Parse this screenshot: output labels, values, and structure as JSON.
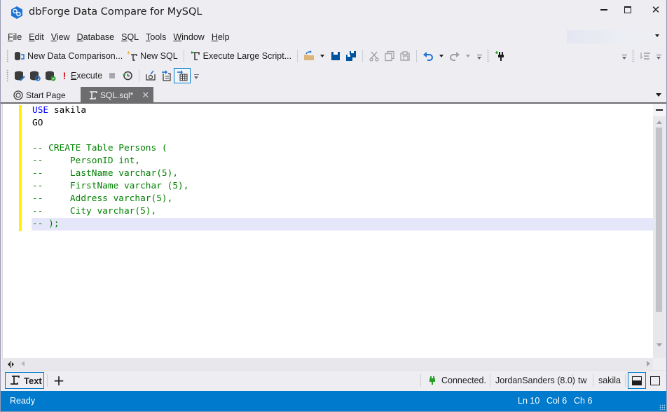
{
  "window": {
    "title": "dbForge Data Compare for MySQL",
    "controls": {
      "minimize": "minimize",
      "maximize": "maximize",
      "close": "close"
    }
  },
  "menu": {
    "items": [
      {
        "label": "File",
        "mnemonic": "F",
        "rest": "ile"
      },
      {
        "label": "Edit",
        "mnemonic": "E",
        "rest": "dit"
      },
      {
        "label": "View",
        "mnemonic": "V",
        "rest": "iew"
      },
      {
        "label": "Database",
        "mnemonic": "D",
        "rest": "atabase"
      },
      {
        "label": "SQL",
        "mnemonic": "S",
        "rest": "QL"
      },
      {
        "label": "Tools",
        "mnemonic": "T",
        "rest": "ools"
      },
      {
        "label": "Window",
        "mnemonic": "W",
        "rest": "indow"
      },
      {
        "label": "Help",
        "mnemonic": "H",
        "rest": "elp"
      }
    ]
  },
  "toolbar_main": {
    "new_data_comparison": "New Data Comparison...",
    "new_sql": "New SQL",
    "execute_large_script": "Execute Large Script...",
    "icons": [
      "open-folder-icon",
      "save-icon",
      "save-all-icon",
      "cut-icon",
      "copy-icon",
      "paste-icon",
      "undo-icon",
      "redo-icon",
      "connect-plug-icon",
      "format-icon"
    ]
  },
  "toolbar_sql": {
    "execute_label": "Execute",
    "execute_mnemonic": "E",
    "execute_rest": "xecute",
    "icons": [
      "db-edit-icon",
      "db-refresh-icon",
      "db-check-icon",
      "exclamation-icon",
      "stop-icon",
      "history-icon",
      "email-icon",
      "export-document-icon",
      "export-grid-icon"
    ]
  },
  "tabs": [
    {
      "label": "Start Page",
      "icon": "start-page-icon",
      "active": false
    },
    {
      "label": "SQL.sql*",
      "icon": "sql-script-icon",
      "active": true
    }
  ],
  "editor": {
    "lines": [
      {
        "tokens": [
          {
            "t": "kw",
            "v": "USE"
          },
          {
            "t": "id",
            "v": " sakila"
          }
        ]
      },
      {
        "tokens": [
          {
            "t": "id",
            "v": "GO"
          }
        ]
      },
      {
        "tokens": [
          {
            "t": "id",
            "v": ""
          }
        ]
      },
      {
        "tokens": [
          {
            "t": "cm",
            "v": "-- CREATE Table Persons ("
          }
        ]
      },
      {
        "tokens": [
          {
            "t": "cm",
            "v": "--     PersonID int,"
          }
        ]
      },
      {
        "tokens": [
          {
            "t": "cm",
            "v": "--     LastName varchar(5),"
          }
        ]
      },
      {
        "tokens": [
          {
            "t": "cm",
            "v": "--     FirstName varchar (5),"
          }
        ]
      },
      {
        "tokens": [
          {
            "t": "cm",
            "v": "--     Address varchar(5),"
          }
        ]
      },
      {
        "tokens": [
          {
            "t": "cm",
            "v": "--     City varchar(5),"
          }
        ]
      },
      {
        "tokens": [
          {
            "t": "cm",
            "v": "-- );"
          }
        ],
        "current": true
      }
    ],
    "colors": {
      "keyword": "#0000ff",
      "comment": "#008000",
      "current_line": "#e6e6fa",
      "change_marker": "#fff200"
    }
  },
  "bottom_panel": {
    "text_button": "Text",
    "add_button": "+",
    "connection_status": "Connected.",
    "connection_name": "JordanSanders (8.0)",
    "user": "tw",
    "database": "sakila"
  },
  "status_bar": {
    "state": "Ready",
    "line": "Ln 10",
    "col": "Col 6",
    "ch": "Ch 6",
    "color": "#007acc"
  }
}
